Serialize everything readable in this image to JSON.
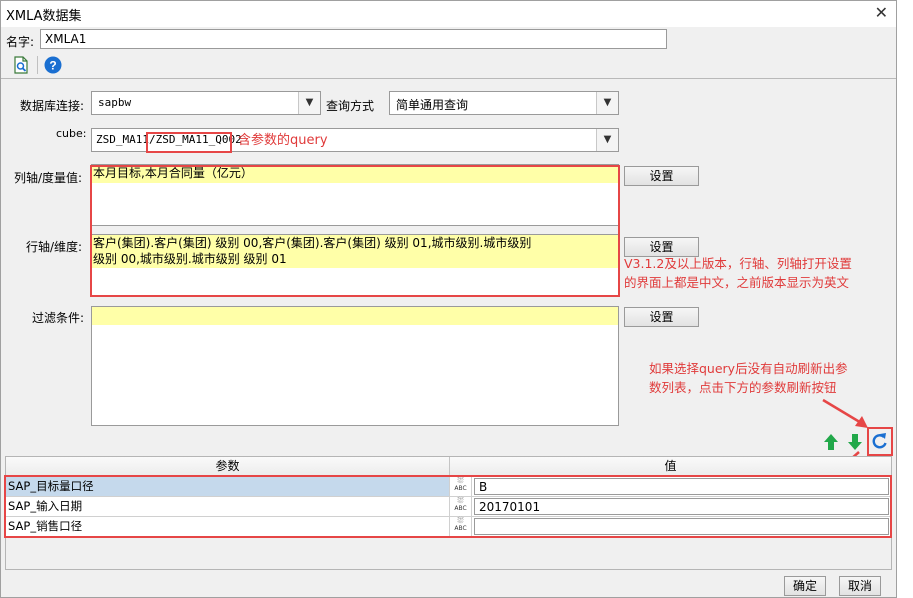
{
  "window": {
    "title": "XMLA数据集",
    "close_icon": "close-icon"
  },
  "name_field": {
    "label": "名字:",
    "value": "XMLA1"
  },
  "toolbar": {
    "preview_icon": "preview-icon",
    "help_icon": "help-icon"
  },
  "connection": {
    "label": "数据库连接:",
    "value": "sapbw"
  },
  "query_mode": {
    "label": "查询方式",
    "value": "简单通用查询"
  },
  "cube": {
    "label": "cube:",
    "value_prefix": "ZSD_MA11/",
    "value_query": "ZSD_MA11_Q002"
  },
  "columns_axis": {
    "label": "列轴/度量值:",
    "value": "本月目标,本月合同量（亿元）",
    "button": "设置"
  },
  "rows_axis": {
    "label": "行轴/维度:",
    "value_line1": "客户(集团).客户(集团) 级别 00,客户(集团).客户(集团) 级别 01,城市级别.城市级别",
    "value_line2": "级别 00,城市级别.城市级别 级别 01",
    "button": "设置"
  },
  "filter": {
    "label": "过滤条件:",
    "value": "",
    "button": "设置"
  },
  "annotations": {
    "cube_note": "含参数的query",
    "axis_note_line1": "V3.1.2及以上版本，行轴、列轴打开设置",
    "axis_note_line2": "的界面上都是中文，之前版本显示为英文",
    "refresh_note_line1": "如果选择query后没有自动刷新出参",
    "refresh_note_line2": "数列表，点击下方的参数刷新按钮"
  },
  "param_actions": {
    "up_icon": "arrow-up-icon",
    "down_icon": "arrow-down-icon",
    "refresh_icon": "refresh-icon"
  },
  "param_table": {
    "headers": [
      "参数",
      "值"
    ],
    "rows": [
      {
        "name": "SAP_目标量口径",
        "type": "ABC",
        "value": "B"
      },
      {
        "name": "SAP_输入日期",
        "type": "ABC",
        "value": "20170101"
      },
      {
        "name": "SAP_销售口径",
        "type": "ABC",
        "value": ""
      }
    ]
  },
  "footer": {
    "ok": "确定",
    "cancel": "取消"
  },
  "colors": {
    "accent_red": "#e64646",
    "highlight_yellow": "#ffffa8",
    "selected_row": "#c5d9ec",
    "arrow_green": "#22a84a",
    "help_blue": "#1a6fd1"
  }
}
